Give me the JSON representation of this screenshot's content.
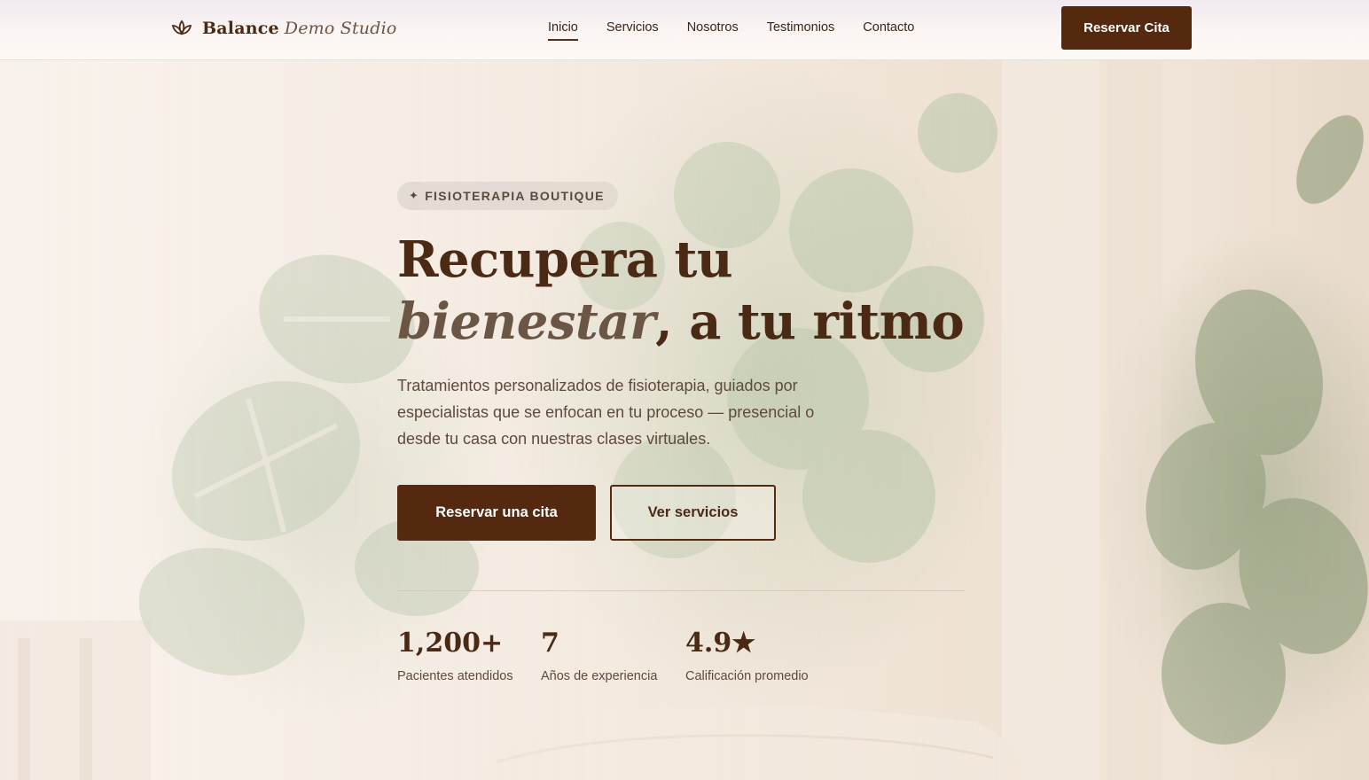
{
  "header": {
    "brand": {
      "name": "Balance",
      "sub": "Demo Studio",
      "icon": "lotus-icon"
    },
    "nav": [
      {
        "label": "Inicio",
        "active": true
      },
      {
        "label": "Servicios",
        "active": false
      },
      {
        "label": "Nosotros",
        "active": false
      },
      {
        "label": "Testimonios",
        "active": false
      },
      {
        "label": "Contacto",
        "active": false
      }
    ],
    "cta_label": "Reservar Cita"
  },
  "hero": {
    "badge": {
      "icon": "sparkle-icon",
      "glyph": "✦",
      "text": "FISIOTERAPIA BOUTIQUE"
    },
    "title": {
      "line1": "Recupera tu",
      "emphasis": "bienestar",
      "rest": ", a tu ritmo"
    },
    "lead": "Tratamientos personalizados de fisioterapia, guiados por especialistas que se enfocan en tu proceso — presencial o desde tu casa con nuestras clases virtuales.",
    "primary_button": "Reservar una cita",
    "secondary_button": "Ver servicios",
    "stats": [
      {
        "value": "1,200+",
        "label": "Pacientes atendidos"
      },
      {
        "value": "7",
        "label": "Años de experiencia"
      },
      {
        "value": "4.9★",
        "label": "Calificación promedio"
      }
    ]
  },
  "colors": {
    "brand_brown": "#55290f",
    "text_brown": "#4a2a14",
    "muted_brown": "#6b5646",
    "background_cream": "#f3ebe2"
  }
}
